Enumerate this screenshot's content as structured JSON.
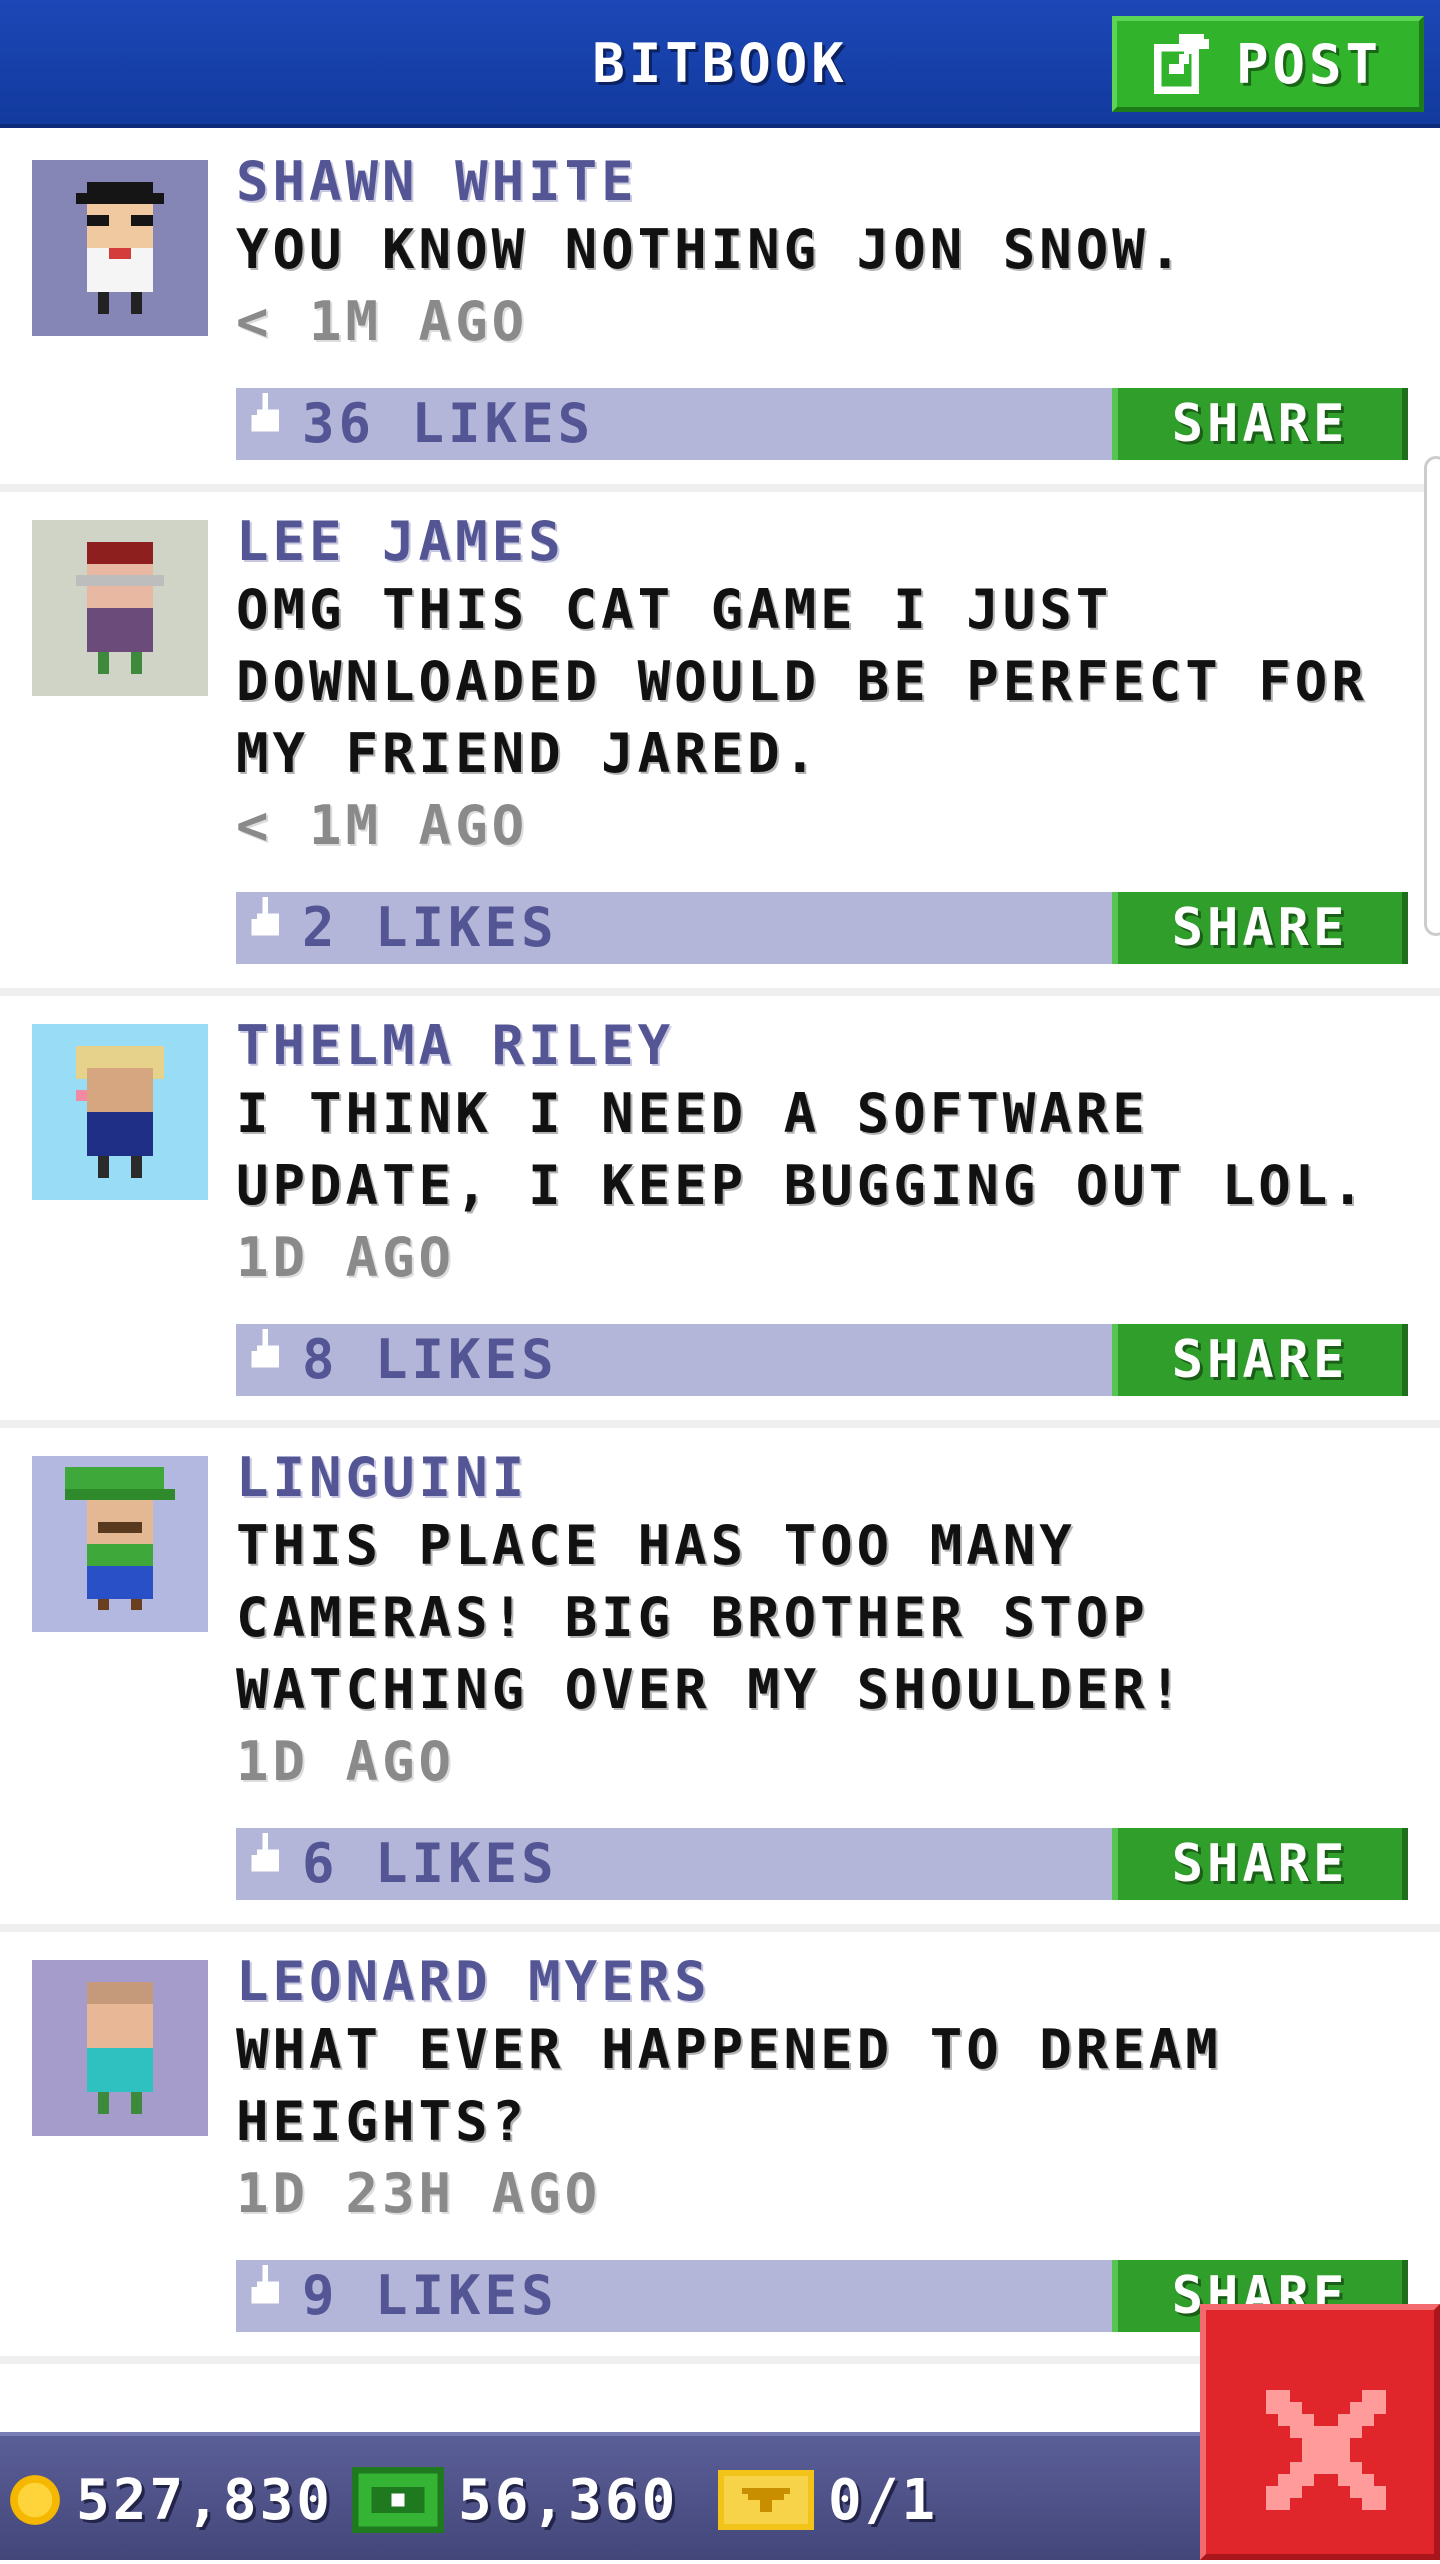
{
  "header": {
    "title": "BITBOOK",
    "post_label": "POST",
    "post_icon": "edit-icon"
  },
  "feed": [
    {
      "author": "SHAWN WHITE",
      "message": "YOU KNOW NOTHING JON SNOW.",
      "time": "< 1M AGO",
      "likes": "36 LIKES",
      "share_label": "SHARE",
      "avatar_bg": "#8586b6"
    },
    {
      "author": "LEE JAMES",
      "message": "OMG THIS CAT GAME I JUST DOWNLOADED WOULD BE PERFECT FOR MY FRIEND JARED.",
      "time": "< 1M AGO",
      "likes": "2 LIKES",
      "share_label": "SHARE",
      "avatar_bg": "#d0d4c6"
    },
    {
      "author": "THELMA RILEY",
      "message": "I THINK I NEED A SOFTWARE UPDATE, I KEEP BUGGING OUT LOL.",
      "time": "1D AGO",
      "likes": "8 LIKES",
      "share_label": "SHARE",
      "avatar_bg": "#98dcf5"
    },
    {
      "author": "LINGUINI",
      "message": "THIS PLACE HAS TOO MANY CAMERAS! BIG BROTHER STOP WATCHING OVER MY SHOULDER!",
      "time": "1D AGO",
      "likes": "6 LIKES",
      "share_label": "SHARE",
      "avatar_bg": "#b3b8e0"
    },
    {
      "author": "LEONARD MYERS",
      "message": "WHAT EVER HAPPENED TO DREAM HEIGHTS?",
      "time": "1D 23H AGO",
      "likes": "9 LIKES",
      "share_label": "SHARE",
      "avatar_bg": "#a59ccc"
    }
  ],
  "status_bar": {
    "coins": "527,830",
    "bux": "56,360",
    "vip": "0/1"
  },
  "colors": {
    "header": "#1c47b6",
    "post_button": "#31b32b",
    "author_text": "#545594",
    "likes_bar": "#b3b6d9",
    "share_button": "#2f9e2a",
    "bottom_bar": "#5b5f98",
    "close_button": "#e0262b",
    "coin": "#f5b700",
    "bux": "#2e9e2e",
    "vip": "#f2c318"
  }
}
